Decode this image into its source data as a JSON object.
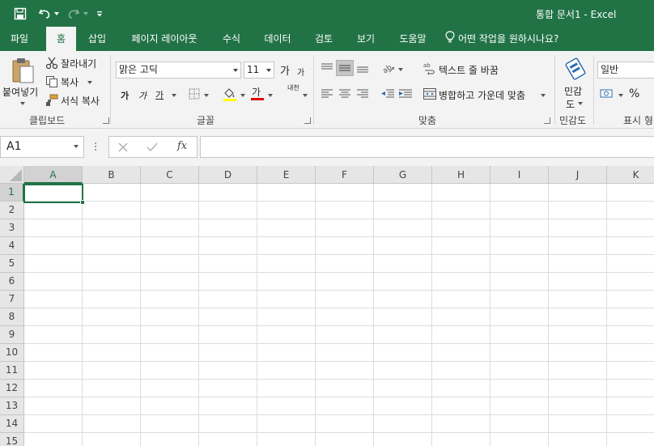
{
  "window": {
    "title": "통합 문서1  -  Excel"
  },
  "quick_access": {
    "save_icon": "save-icon",
    "undo_icon": "undo-icon",
    "redo_icon": "redo-icon",
    "customize_icon": "customize-qat-icon"
  },
  "tabs": [
    {
      "label": "파일",
      "active": false
    },
    {
      "label": "홈",
      "active": true
    },
    {
      "label": "삽입",
      "active": false
    },
    {
      "label": "페이지 레이아웃",
      "active": false
    },
    {
      "label": "수식",
      "active": false
    },
    {
      "label": "데이터",
      "active": false
    },
    {
      "label": "검토",
      "active": false
    },
    {
      "label": "보기",
      "active": false
    },
    {
      "label": "도움말",
      "active": false
    }
  ],
  "tell_me": "어떤 작업을 원하시나요?",
  "ribbon": {
    "clipboard": {
      "label": "클립보드",
      "paste": "붙여넣기",
      "cut": "잘라내기",
      "copy": "복사",
      "format_painter": "서식 복사"
    },
    "font": {
      "label": "글꼴",
      "font_name": "맑은 고딕",
      "font_size": "11",
      "grow": "가",
      "shrink": "가",
      "bold": "가",
      "italic": "가",
      "underline": "가",
      "font_color_glyph": "가",
      "phonetic": "내천",
      "font_color": "#e00000",
      "fill_color": "#ffff00"
    },
    "alignment": {
      "label": "맞춤",
      "wrap_text": "텍스트 줄 바꿈",
      "merge_center": "병합하고 가운데 맞춤"
    },
    "sensitivity": {
      "label": "민감도",
      "button_line1": "민감",
      "button_line2": "도"
    },
    "number": {
      "label": "표시 형식",
      "format": "일반",
      "percent": "%"
    }
  },
  "formula_bar": {
    "name_box": "A1",
    "fx": "fx",
    "formula": ""
  },
  "grid": {
    "columns": [
      "A",
      "B",
      "C",
      "D",
      "E",
      "F",
      "G",
      "H",
      "I",
      "J",
      "K"
    ],
    "rows": [
      "1",
      "2",
      "3",
      "4",
      "5",
      "6",
      "7",
      "8",
      "9",
      "10",
      "11",
      "12",
      "13",
      "14",
      "15"
    ],
    "selected_cell": "A1",
    "accent": "#217346"
  }
}
